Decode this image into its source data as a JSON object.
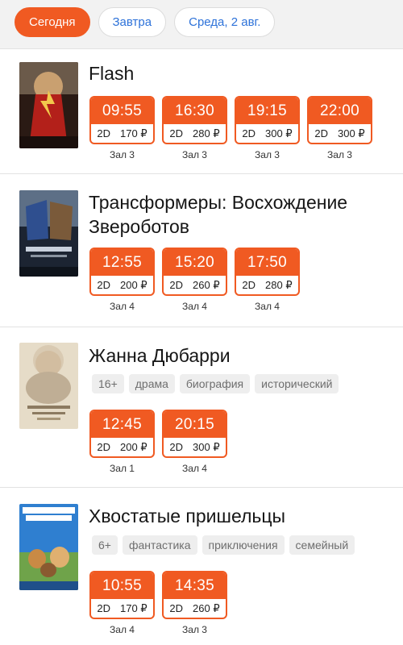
{
  "tabs": [
    {
      "label": "Сегодня",
      "active": true
    },
    {
      "label": "Завтра",
      "active": false
    },
    {
      "label": "Среда, 2 авг.",
      "active": false
    }
  ],
  "colors": {
    "accent": "#f05a22",
    "link": "#2d72d9",
    "tag_bg": "#eeeeee"
  },
  "movies": [
    {
      "title": "Flash",
      "tags": [],
      "sessions": [
        {
          "time": "09:55",
          "format": "2D",
          "price": "170 ₽",
          "hall": "Зал 3"
        },
        {
          "time": "16:30",
          "format": "2D",
          "price": "280 ₽",
          "hall": "Зал 3"
        },
        {
          "time": "19:15",
          "format": "2D",
          "price": "300 ₽",
          "hall": "Зал 3"
        },
        {
          "time": "22:00",
          "format": "2D",
          "price": "300 ₽",
          "hall": "Зал 3"
        }
      ]
    },
    {
      "title": "Трансформеры: Восхождение Звероботов",
      "tags": [],
      "sessions": [
        {
          "time": "12:55",
          "format": "2D",
          "price": "200 ₽",
          "hall": "Зал 4"
        },
        {
          "time": "15:20",
          "format": "2D",
          "price": "260 ₽",
          "hall": "Зал 4"
        },
        {
          "time": "17:50",
          "format": "2D",
          "price": "280 ₽",
          "hall": "Зал 4"
        }
      ]
    },
    {
      "title": "Жанна Дюбарри",
      "tags": [
        "16+",
        "драма",
        "биография",
        "исторический"
      ],
      "sessions": [
        {
          "time": "12:45",
          "format": "2D",
          "price": "200 ₽",
          "hall": "Зал 1"
        },
        {
          "time": "20:15",
          "format": "2D",
          "price": "300 ₽",
          "hall": "Зал 4"
        }
      ]
    },
    {
      "title": "Хвостатые пришельцы",
      "tags": [
        "6+",
        "фантастика",
        "приключения",
        "семейный"
      ],
      "sessions": [
        {
          "time": "10:55",
          "format": "2D",
          "price": "170 ₽",
          "hall": "Зал 4"
        },
        {
          "time": "14:35",
          "format": "2D",
          "price": "260 ₽",
          "hall": "Зал 3"
        }
      ]
    }
  ]
}
